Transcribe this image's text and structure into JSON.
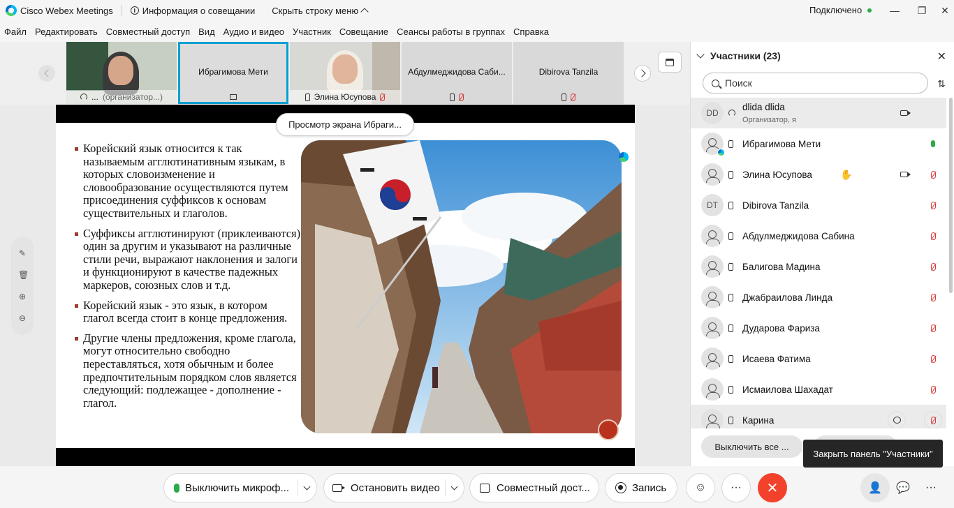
{
  "app": {
    "title": "Cisco Webex Meetings",
    "meeting_info_label": "Информация о совещании",
    "hide_menu_label": "Скрыть строку меню",
    "connection_status": "Подключено"
  },
  "menu": [
    "Файл",
    "Редактировать",
    "Совместный доступ",
    "Вид",
    "Аудио и видео",
    "Участник",
    "Совещание",
    "Сеансы работы в группах",
    "Справка"
  ],
  "thumbnails": [
    {
      "name": "...",
      "role": "(организатор...)"
    },
    {
      "name": "Ибрагимова Мети"
    },
    {
      "name": "Элина Юсупова"
    },
    {
      "name": "Абдулмеджидова Саби..."
    },
    {
      "name": "Dibirova Tanzila"
    }
  ],
  "share": {
    "pill_label": "Просмотр экрана Ибраги...",
    "slide_bullets": [
      "Корейский язык относится к так называемым агглютинативным языкам, в которых словоизменение и словообразование осуществляются путем присоединения суффиксов к основам существительных и глаголов.",
      "Суффиксы агглютинируют (приклеиваются) один за другим и указывают на различные стили речи, выражают наклонения и залоги и функционируют в качестве падежных маркеров, союзных слов и т.д.",
      "Корейский язык - это язык, в котором глагол всегда стоит в конце предложения.",
      "Другие члены предложения, кроме глагола, могут относительно свободно переставляться, хотя обычным и более предпочтительным порядком слов является следующий: подлежащее - дополнение - глагол."
    ]
  },
  "participants": {
    "title": "Участники (23)",
    "search_placeholder": "Поиск",
    "list": [
      {
        "initials": "DD",
        "name": "dlida dlida",
        "role": "Организатор, я"
      },
      {
        "name": "Ибрагимова Мети"
      },
      {
        "name": "Элина Юсупова"
      },
      {
        "initials": "DT",
        "name": "Dibirova Tanzila"
      },
      {
        "name": "Абдулмеджидова Сабина"
      },
      {
        "name": "Балигова Мадина"
      },
      {
        "name": "Джабраилова Линда"
      },
      {
        "name": "Дударова Фариза"
      },
      {
        "name": "Исаева Фатима"
      },
      {
        "name": "Исмаилова Шахадат"
      },
      {
        "name": "Карина"
      }
    ],
    "mute_all_label": "Выключить все ...",
    "close_tooltip": "Закрыть панель \"Участники\""
  },
  "controls": {
    "mic_label": "Выключить микроф...",
    "video_label": "Остановить видео",
    "share_label": "Совместный дост...",
    "record_label": "Запись"
  },
  "colors": {
    "end_call": "#f2422c",
    "mic_active": "#2bab4a",
    "muted": "#d63a3a",
    "accent_selected": "#00a0d1"
  }
}
